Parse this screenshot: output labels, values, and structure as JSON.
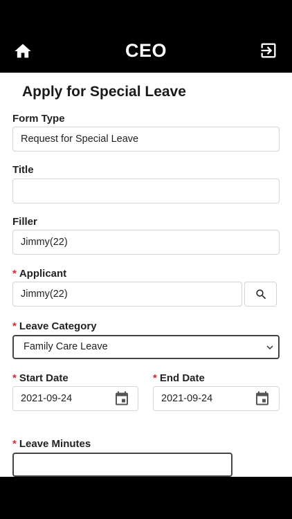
{
  "header": {
    "title": "CEO"
  },
  "form": {
    "page_title": "Apply for Special Leave",
    "form_type": {
      "label": "Form Type",
      "value": "Request for Special Leave"
    },
    "title": {
      "label": "Title",
      "value": ""
    },
    "filler": {
      "label": "Filler",
      "value": "Jimmy(22)"
    },
    "applicant": {
      "label": "Applicant",
      "value": "Jimmy(22)",
      "required": "*"
    },
    "leave_category": {
      "label": "Leave Category",
      "value": "Family Care Leave",
      "required": "*"
    },
    "start_date": {
      "label": "Start Date",
      "value": "2021-09-24",
      "required": "*"
    },
    "end_date": {
      "label": "End Date",
      "value": "2021-09-24",
      "required": "*"
    },
    "leave_minutes": {
      "label": "Leave Minutes",
      "value": "",
      "required": "*"
    }
  },
  "colors": {
    "header_bg": "#000000",
    "required": "#d9262c",
    "icon_gray": "#555555"
  }
}
